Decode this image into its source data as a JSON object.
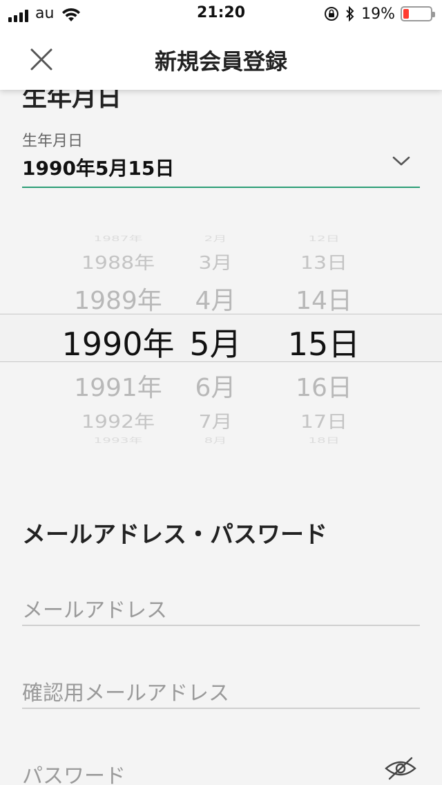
{
  "status_bar": {
    "carrier": "au",
    "time": "21:20",
    "battery_percent_text": "19%",
    "battery_level": 0.19,
    "battery_color": "#ff3b30"
  },
  "header": {
    "title": "新規会員登録",
    "close_icon": "close-icon"
  },
  "birthday_section": {
    "heading": "生年月日",
    "field_label": "生年月日",
    "field_value": "1990年5月15日",
    "accent_color": "#2a9d74"
  },
  "picker": {
    "years": [
      "1987年",
      "1988年",
      "1989年",
      "1990年",
      "1991年",
      "1992年",
      "1993年"
    ],
    "months": [
      "2月",
      "3月",
      "4月",
      "5月",
      "6月",
      "7月",
      "8月"
    ],
    "days": [
      "12日",
      "13日",
      "14日",
      "15日",
      "16日",
      "17日",
      "18日"
    ]
  },
  "account_section": {
    "heading": "メールアドレス・パスワード",
    "email_placeholder": "メールアドレス",
    "email_confirm_placeholder": "確認用メールアドレス",
    "password_placeholder": "パスワード"
  }
}
